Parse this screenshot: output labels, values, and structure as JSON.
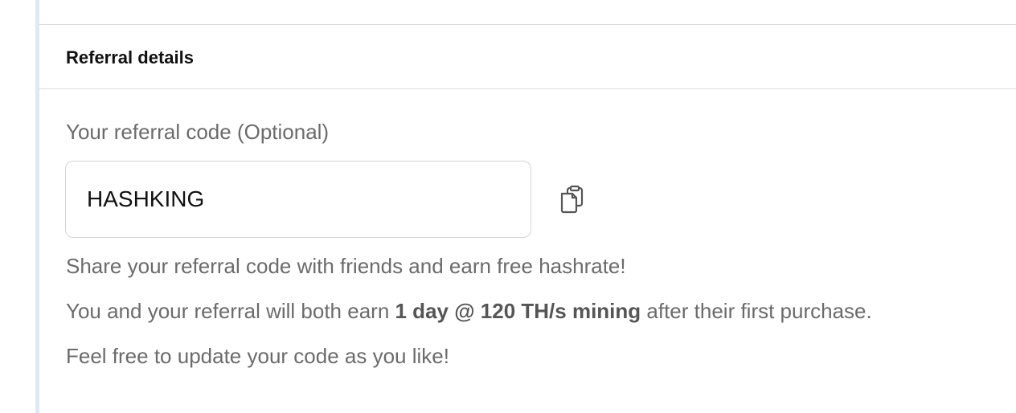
{
  "section": {
    "title": "Referral details"
  },
  "referral": {
    "label": "Your referral code (Optional)",
    "code_value": "HASHKING",
    "copy_icon": "clipboard-copy-icon"
  },
  "help": {
    "line1": "Share your referral code with friends and earn free hashrate!",
    "line2_prefix": "You and your referral will both earn ",
    "line2_bold": "1 day @ 120 TH/s mining",
    "line2_suffix": " after their first purchase.",
    "line3": "Feel free to update your code as you like!"
  },
  "colors": {
    "accent_rail": "#dde9f5",
    "text_muted": "#6b6b6b",
    "border": "#d4d4d4"
  }
}
